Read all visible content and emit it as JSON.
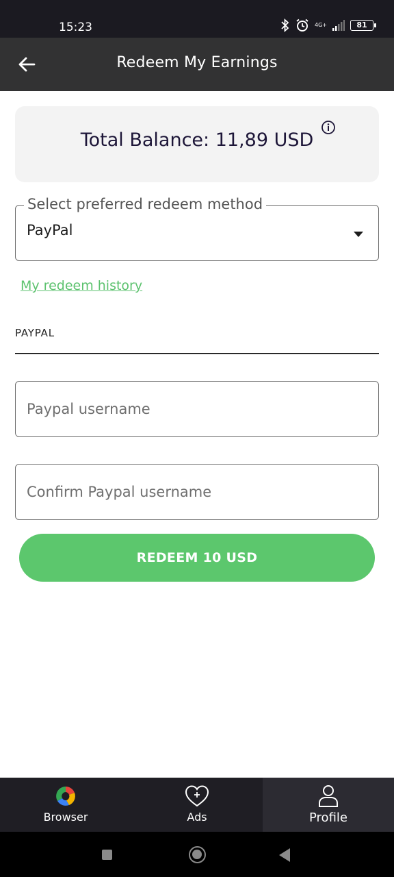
{
  "status_bar": {
    "time": "15:23",
    "network": "4G+",
    "battery": "81",
    "icons": [
      "bluetooth-icon",
      "alarm-icon",
      "signal-icon",
      "battery-icon"
    ]
  },
  "app_bar": {
    "title": "Redeem My Earnings",
    "back_icon": "arrow-left-icon"
  },
  "balance": {
    "text": "Total Balance: 11,89 USD",
    "info_icon": "info-icon"
  },
  "redeem_method": {
    "label": "Select preferred redeem method",
    "selected": "PayPal"
  },
  "history_link": "My redeem history",
  "section_label": "PAYPAL",
  "fields": {
    "username_placeholder": "Paypal username",
    "confirm_placeholder": "Confirm Paypal username"
  },
  "redeem_button": "REDEEM 10 USD",
  "bottom_nav": {
    "items": [
      {
        "label": "Browser",
        "icon": "browser-logo-icon",
        "active": false
      },
      {
        "label": "Ads",
        "icon": "heart-plus-icon",
        "active": false
      },
      {
        "label": "Profile",
        "icon": "profile-icon",
        "active": true
      }
    ]
  },
  "colors": {
    "accent": "#5cc76d",
    "app_bar": "#323233",
    "bottom_nav": "#1f1e24"
  }
}
